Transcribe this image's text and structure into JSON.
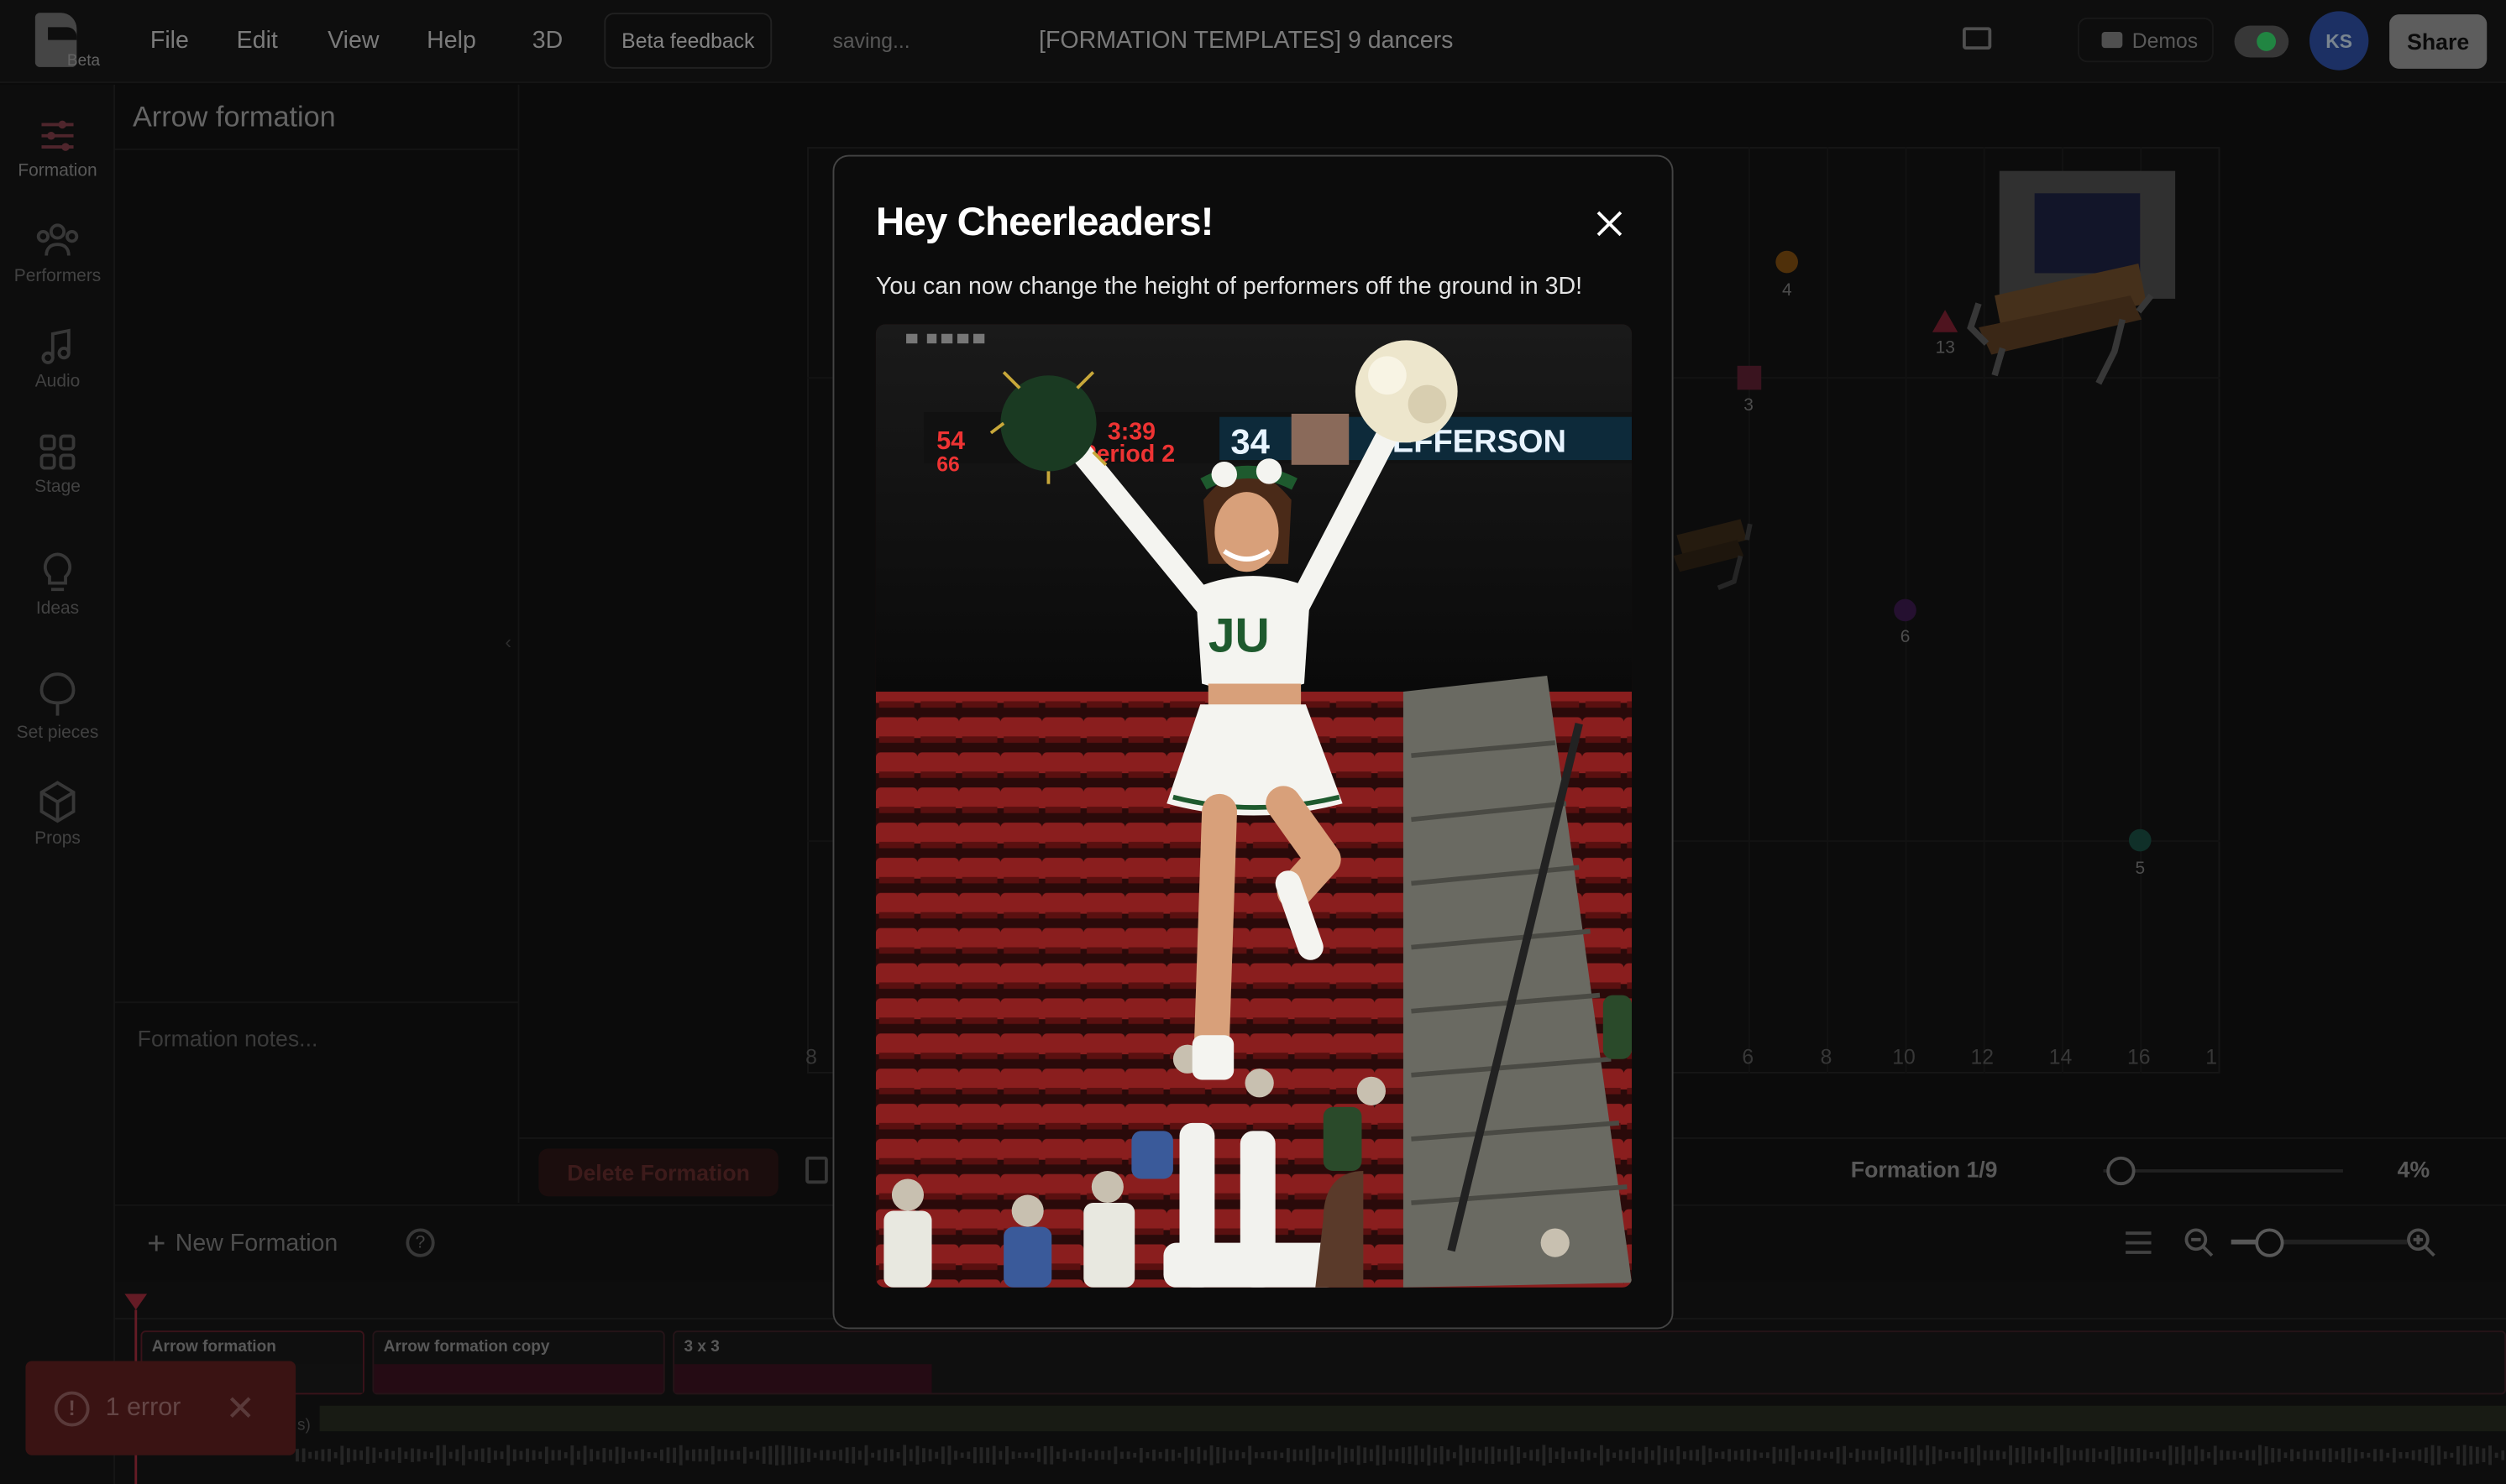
{
  "topbar": {
    "logo_badge": "Beta",
    "menu": [
      "File",
      "Edit",
      "View",
      "Help",
      "3D"
    ],
    "beta_feedback": "Beta feedback",
    "status": "saving...",
    "document_title": "[FORMATION TEMPLATES] 9 dancers",
    "demos_label": "Demos",
    "avatar_initials": "KS",
    "share_label": "Share"
  },
  "sidebar": {
    "items": [
      {
        "label": "Formation",
        "icon": "sliders-icon"
      },
      {
        "label": "Performers",
        "icon": "people-icon"
      },
      {
        "label": "Audio",
        "icon": "music-note-icon"
      },
      {
        "label": "Stage",
        "icon": "grid-icon"
      },
      {
        "label": "Ideas",
        "icon": "lightbulb-icon"
      },
      {
        "label": "Set pieces",
        "icon": "tree-icon"
      },
      {
        "label": "Props",
        "icon": "box-icon"
      }
    ]
  },
  "left_panel": {
    "title": "Arrow formation",
    "notes_placeholder": "Formation notes..."
  },
  "stage": {
    "axis_labels": [
      "8",
      "6",
      "8",
      "10",
      "12",
      "14",
      "16",
      "1"
    ],
    "performer_labels": [
      "4",
      "13",
      "3",
      "6",
      "5"
    ]
  },
  "controls": {
    "delete_label": "Delete Formation",
    "formation_counter": "Formation 1/9",
    "zoom_percent": "4%",
    "new_formation": "New Formation"
  },
  "timeline": {
    "clips": [
      "Arrow formation",
      "Arrow formation copy",
      "3 x 3"
    ],
    "audio_label": "s)"
  },
  "error_toast": {
    "label": "1 error"
  },
  "modal": {
    "title": "Hey Cheerleaders!",
    "body": "You can now change the height of performers off the ground in 3D!",
    "scoreboard": {
      "score_a": "54",
      "score_b": "66",
      "clock": "3:39",
      "period": "Period 2",
      "player_number": "34",
      "player_name": "JEFFERSON"
    },
    "uniform_text": "JU"
  },
  "colors": {
    "accent_red": "#c0314a",
    "modal_bg": "#0c0c0c",
    "performer_orange": "#c07a1a",
    "performer_pink": "#c0314a",
    "performer_purple": "#7a2a9a",
    "performer_teal": "#2a8a7a"
  }
}
